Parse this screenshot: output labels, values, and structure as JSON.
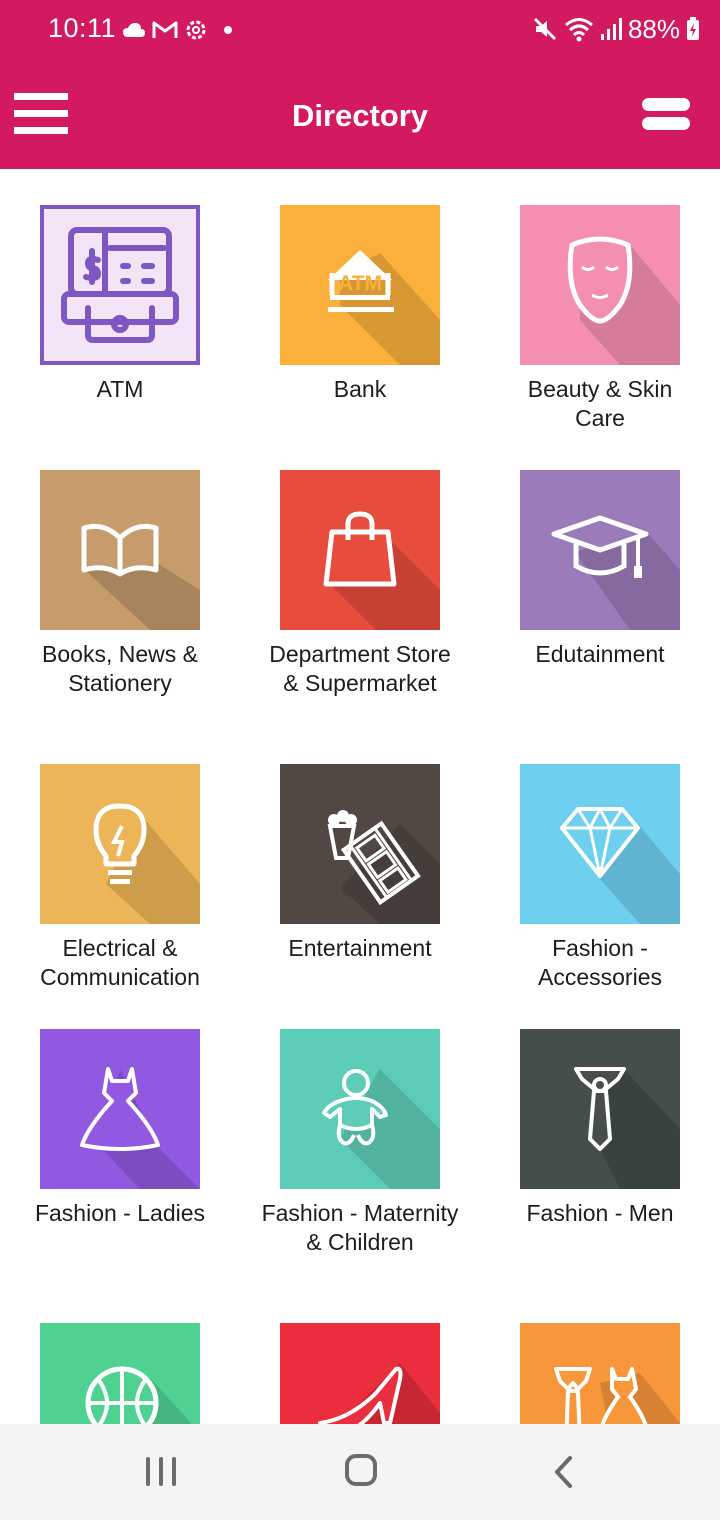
{
  "status_bar": {
    "time": "10:11",
    "battery": "88%",
    "left_icons": [
      "cloud-icon",
      "gmail-icon",
      "settings-icon",
      "dot-icon"
    ],
    "right_icons": [
      "mute-icon",
      "wifi-icon",
      "signal-icon",
      "battery-icon"
    ]
  },
  "app_bar": {
    "title": "Directory",
    "menu_icon": "hamburger-menu-icon",
    "view_icon": "list-view-icon",
    "color": "#d31a60"
  },
  "categories": [
    {
      "label": "ATM",
      "color": "#f3e4f7",
      "icon": "atm-machine-icon"
    },
    {
      "label": "Bank",
      "color": "#fbb03b",
      "icon": "bank-icon"
    },
    {
      "label": "Beauty & Skin Care",
      "color": "#f48fb1",
      "icon": "face-mask-icon"
    },
    {
      "label": "Books, News & Stationery",
      "color": "#c69c6d",
      "icon": "open-book-icon"
    },
    {
      "label": "Department Store & Supermarket",
      "color": "#e74c3c",
      "icon": "shopping-bag-icon"
    },
    {
      "label": "Edutainment",
      "color": "#9b7bba",
      "icon": "graduation-cap-icon"
    },
    {
      "label": "Electrical & Communication",
      "color": "#ecb558",
      "icon": "light-bulb-icon"
    },
    {
      "label": "Entertainment",
      "color": "#524843",
      "icon": "popcorn-film-icon"
    },
    {
      "label": "Fashion - Accessories",
      "color": "#6ecfee",
      "icon": "diamond-icon"
    },
    {
      "label": "Fashion - Ladies",
      "color": "#9159e2",
      "icon": "dress-icon"
    },
    {
      "label": "Fashion - Maternity & Children",
      "color": "#5ecdb7",
      "icon": "baby-icon"
    },
    {
      "label": "Fashion - Men",
      "color": "#454e4a",
      "icon": "necktie-icon"
    },
    {
      "label": "",
      "color": "#4fd191",
      "icon": "basketball-icon"
    },
    {
      "label": "",
      "color": "#ea2e3d",
      "icon": "high-heel-icon"
    },
    {
      "label": "",
      "color": "#f7963a",
      "icon": "clothes-icon"
    }
  ],
  "nav_bar": {
    "icons": [
      "recent-apps-icon",
      "home-icon",
      "back-icon"
    ]
  }
}
